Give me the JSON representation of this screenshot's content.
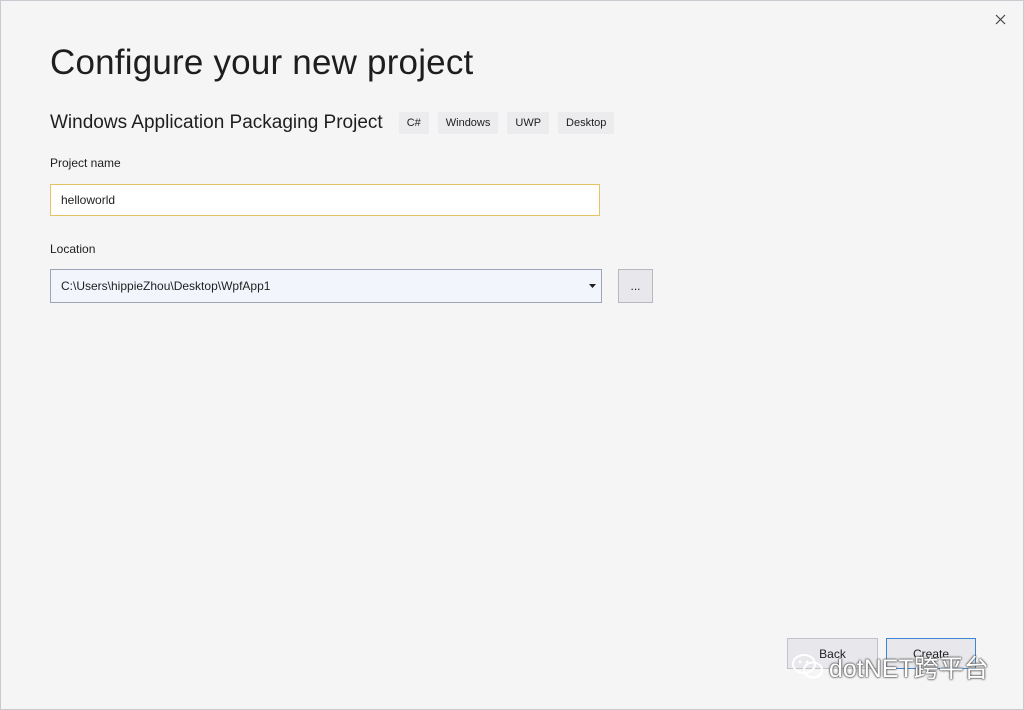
{
  "window": {
    "title": "Configure your new project"
  },
  "template": {
    "name": "Windows Application Packaging Project",
    "tags": [
      "C#",
      "Windows",
      "UWP",
      "Desktop"
    ]
  },
  "project_name": {
    "label": "Project name",
    "value": "helloworld"
  },
  "location": {
    "label": "Location",
    "value": "C:\\Users\\hippieZhou\\Desktop\\WpfApp1",
    "browse_label": "..."
  },
  "footer": {
    "back_label": "Back",
    "create_label": "Create"
  },
  "watermark": {
    "text": "dotNET跨平台"
  },
  "icons": {
    "close": "close-icon",
    "dropdown": "chevron-down-icon",
    "watermark": "wechat-icon"
  },
  "colors": {
    "focus_border": "#e5c365",
    "primary_border": "#3c86d4",
    "combo_background": "#f2f5fc"
  }
}
